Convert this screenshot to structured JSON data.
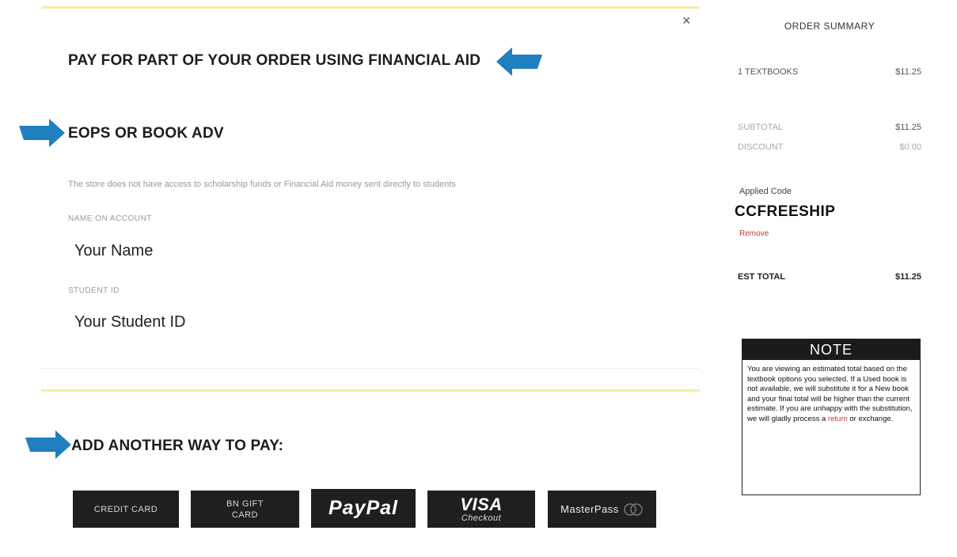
{
  "modal": {
    "close_label": "×",
    "financial_aid_title": "PAY FOR PART OF YOUR ORDER USING FINANCIAL AID",
    "eops_title": "EOPS OR BOOK ADV",
    "disclaimer": "The store does not have access to scholarship funds or Financial Aid money sent directly to students",
    "name_label": "NAME ON ACCOUNT",
    "name_value": "Your Name",
    "student_id_label": "STUDENT ID",
    "student_id_value": "Your Student ID",
    "add_pay_title": "ADD ANOTHER WAY TO PAY:",
    "payment_buttons": {
      "credit_card": "CREDIT CARD",
      "gift_card_line1": "BN GIFT",
      "gift_card_line2": "CARD",
      "paypal": "PayPal",
      "visa_line1": "VISA",
      "visa_line2": "Checkout",
      "masterpass": "MasterPass"
    }
  },
  "summary": {
    "title": "ORDER SUMMARY",
    "items_label": "1 TEXTBOOKS",
    "items_amount": "$11.25",
    "subtotal_label": "SUBTOTAL",
    "subtotal_amount": "$11.25",
    "discount_label": "DISCOUNT",
    "discount_amount": "$0.00",
    "applied_code_label": "Applied Code",
    "applied_code": "CCFREESHIP",
    "remove_label": "Remove",
    "est_total_label": "EST TOTAL",
    "est_total_amount": "$11.25",
    "note_title": "NOTE",
    "note_part1": "You are viewing an estimated total based on the textbook options you selected. If a Used book is not available, we will substitute it for a New book and your final total will be higher than the current estimate. If you are unhappy with the substitution, we will gladly process a ",
    "note_link": "return",
    "note_part2": " or exchange."
  },
  "colors": {
    "arrow_blue": "#1f7fbf",
    "divider_yellow": "#f3eea0",
    "remove_red": "#c0392b"
  },
  "icons": {
    "close": "close-icon",
    "arrow": "arrow-icon",
    "masterpass": "masterpass-circles-icon"
  }
}
